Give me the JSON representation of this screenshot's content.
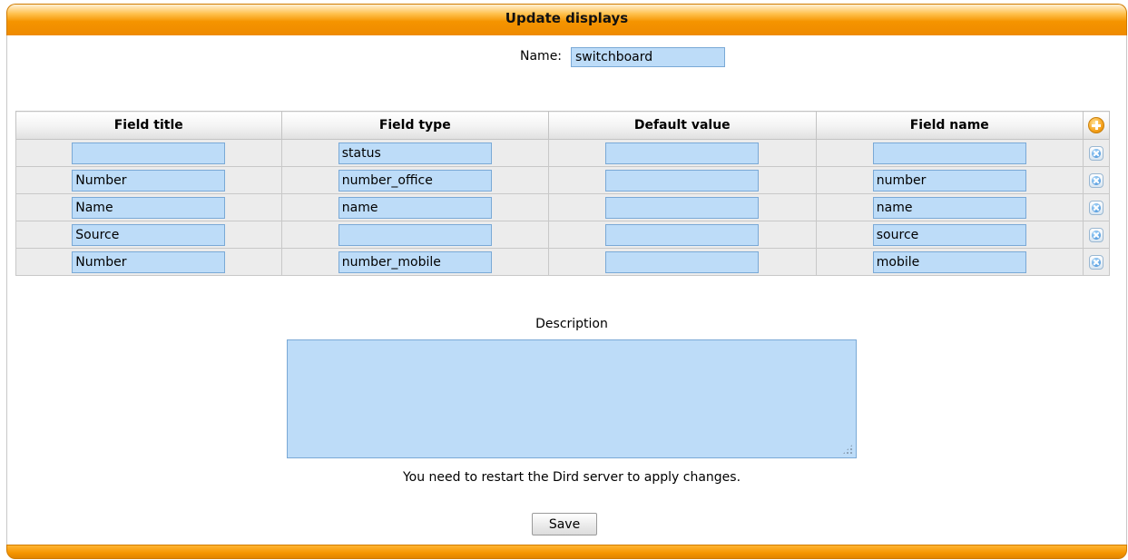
{
  "header": {
    "title": "Update displays"
  },
  "name_field": {
    "label": "Name:",
    "value": "switchboard"
  },
  "table": {
    "columns": [
      "Field title",
      "Field type",
      "Default value",
      "Field name"
    ],
    "rows": [
      {
        "title": "",
        "type": "status",
        "default": "",
        "name": ""
      },
      {
        "title": "Number",
        "type": "number_office",
        "default": "",
        "name": "number"
      },
      {
        "title": "Name",
        "type": "name",
        "default": "",
        "name": "name"
      },
      {
        "title": "Source",
        "type": "",
        "default": "",
        "name": "source"
      },
      {
        "title": "Number",
        "type": "number_mobile",
        "default": "",
        "name": "mobile"
      }
    ],
    "add_icon": "add-plus-icon",
    "delete_icon": "delete-x-icon"
  },
  "description": {
    "label": "Description",
    "value": ""
  },
  "notice": "You need to restart the Dird server to apply changes.",
  "save_label": "Save",
  "colors": {
    "accent": "#f59400",
    "input_bg": "#bddcf8",
    "input_border": "#7aa9d6"
  }
}
